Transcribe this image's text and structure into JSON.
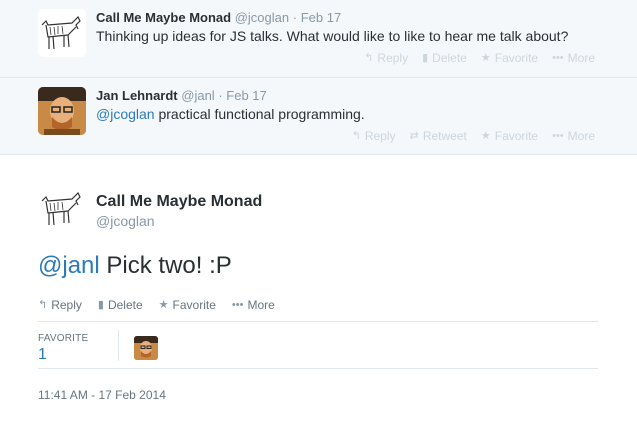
{
  "tweets": [
    {
      "name": "Call Me Maybe Monad",
      "handle": "@jcoglan",
      "dot": "·",
      "date": "Feb 17",
      "text": "Thinking up ideas for JS talks. What would like to like to hear me talk about?",
      "actions": [
        "Reply",
        "Delete",
        "Favorite",
        "More"
      ]
    },
    {
      "name": "Jan Lehnardt",
      "handle": "@janl",
      "dot": "·",
      "date": "Feb 17",
      "mention": "@jcoglan",
      "text": " practical functional programming.",
      "actions": [
        "Reply",
        "Retweet",
        "Favorite",
        "More"
      ]
    }
  ],
  "main": {
    "name": "Call Me Maybe Monad",
    "handle": "@jcoglan",
    "mention": "@janl",
    "text": " Pick two! :P",
    "actions": [
      "Reply",
      "Delete",
      "Favorite",
      "More"
    ],
    "favorite_label": "FAVORITE",
    "favorite_count": "1",
    "timestamp": "11:41 AM - 17 Feb 2014"
  },
  "icons": {
    "reply": "reply-icon",
    "delete": "trash-icon",
    "retweet": "retweet-icon",
    "favorite": "star-icon",
    "more": "more-icon"
  },
  "colors": {
    "link": "#2b7bb9",
    "muted": "#8899a6",
    "reply_bg": "#f5f8fa"
  }
}
